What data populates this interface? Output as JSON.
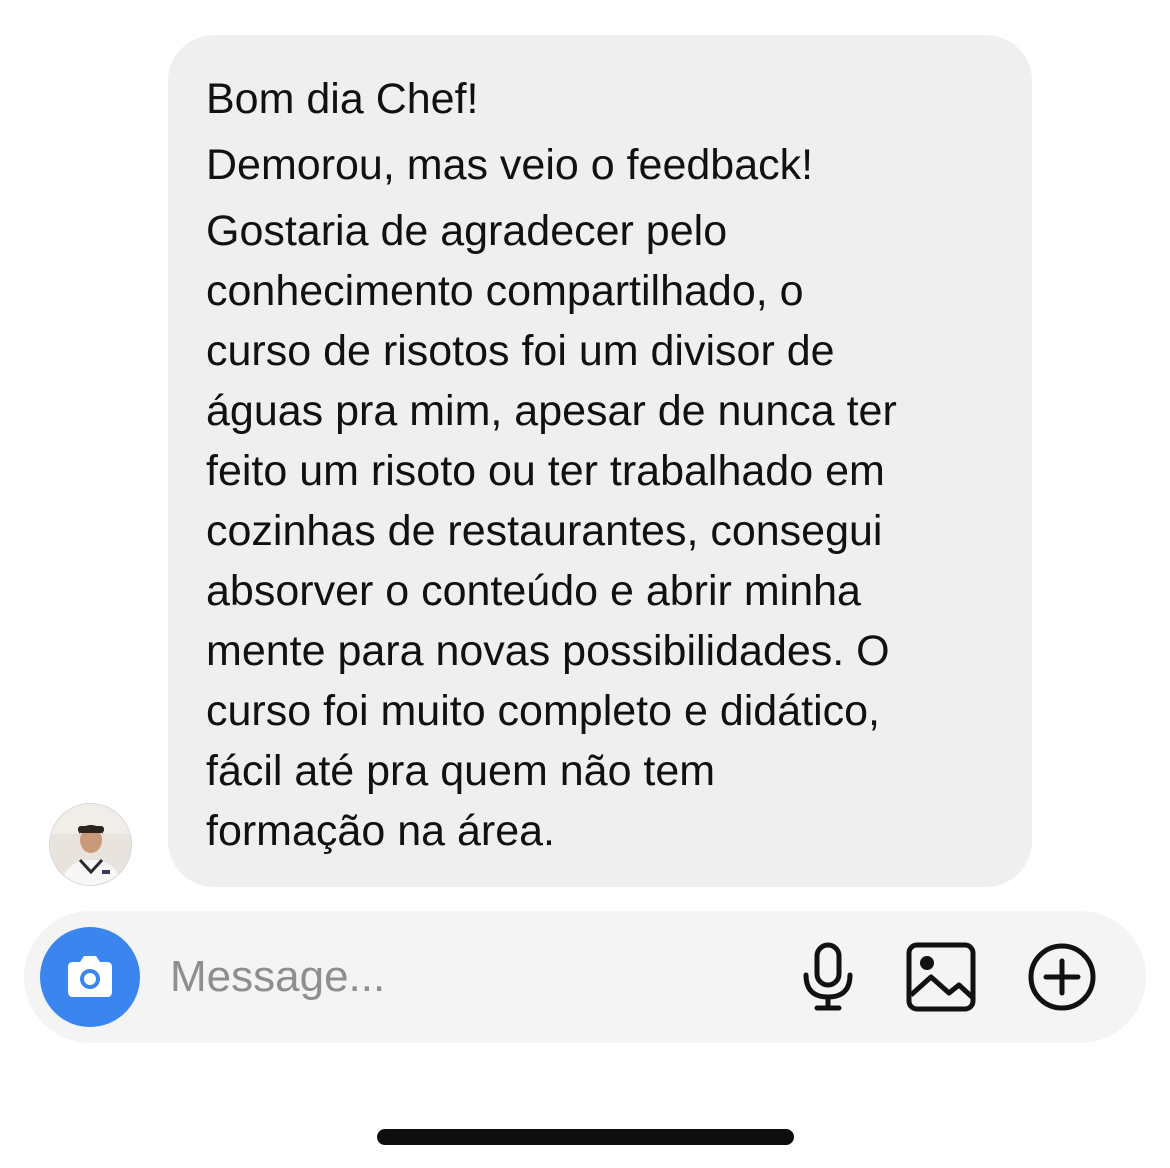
{
  "message": {
    "lines": [
      "Bom dia Chef!",
      "Demorou, mas veio o feedback!",
      "Gostaria de agradecer pelo",
      "conhecimento compartilhado, o",
      "curso de risotos foi um divisor de",
      "águas pra mim, apesar de nunca ter",
      "feito um risoto ou ter trabalhado em",
      "cozinhas de restaurantes, consegui",
      "absorver o conteúdo e abrir minha",
      "mente para novas possibilidades. O",
      "curso foi muito completo e didático,",
      "fácil até pra quem não tem",
      "formação na área."
    ]
  },
  "composer": {
    "placeholder": "Message...",
    "camera_icon": "camera-icon",
    "mic_icon": "microphone-icon",
    "gallery_icon": "image-icon",
    "plus_icon": "plus-circle-icon"
  },
  "colors": {
    "bubble_bg": "#efefef",
    "camera_button": "#3a85ee",
    "placeholder_text": "#8e8e8e"
  }
}
